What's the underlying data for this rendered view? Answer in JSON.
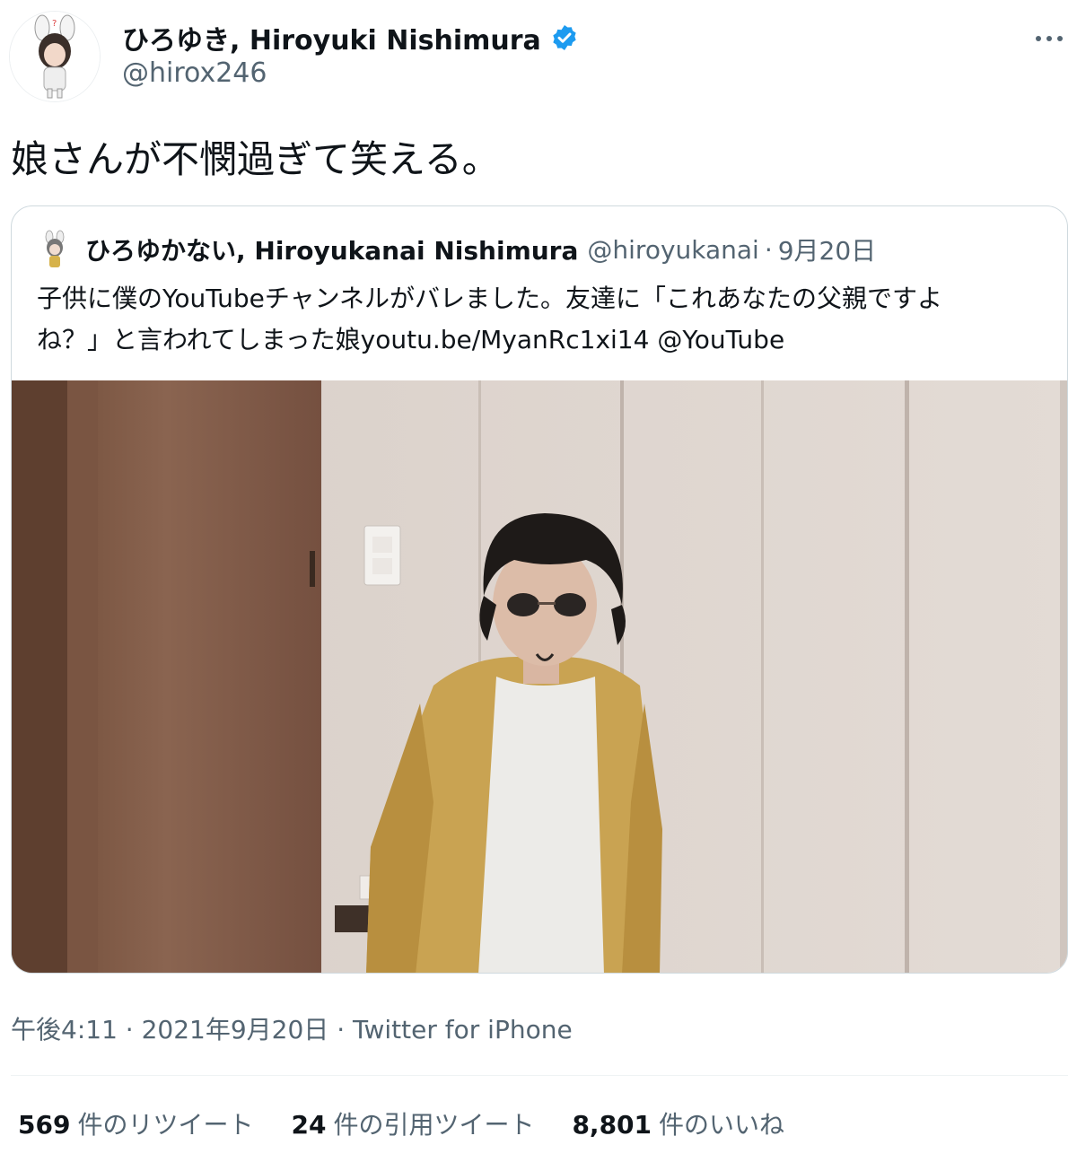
{
  "author": {
    "name": "ひろゆき, Hiroyuki Nishimura",
    "handle": "@hirox246",
    "verified_color": "#1d9bf0"
  },
  "tweet": {
    "text": "娘さんが不憫過ぎて笑える。"
  },
  "quoted": {
    "name": "ひろゆかない, Hiroyukanai Nishimura",
    "handle": "@hiroyukanai",
    "separator": "·",
    "date": "9月20日",
    "text_line1": "子供に僕のYouTubeチャンネルがバレました。友達に「これあなたの父親ですよ",
    "text_line2": "ね？」と言われてしまった娘youtu.be/MyanRc1xi14 @YouTube"
  },
  "meta": {
    "time": "午後4:11",
    "separator": "·",
    "date": "2021年9月20日",
    "source": "Twitter for iPhone"
  },
  "stats": {
    "retweets_count": "569",
    "retweets_label": "件のリツイート",
    "quotes_count": "24",
    "quotes_label": "件の引用ツイート",
    "likes_count": "8,801",
    "likes_label": "件のいいね"
  },
  "more_icon": "more-horizontal-icon"
}
